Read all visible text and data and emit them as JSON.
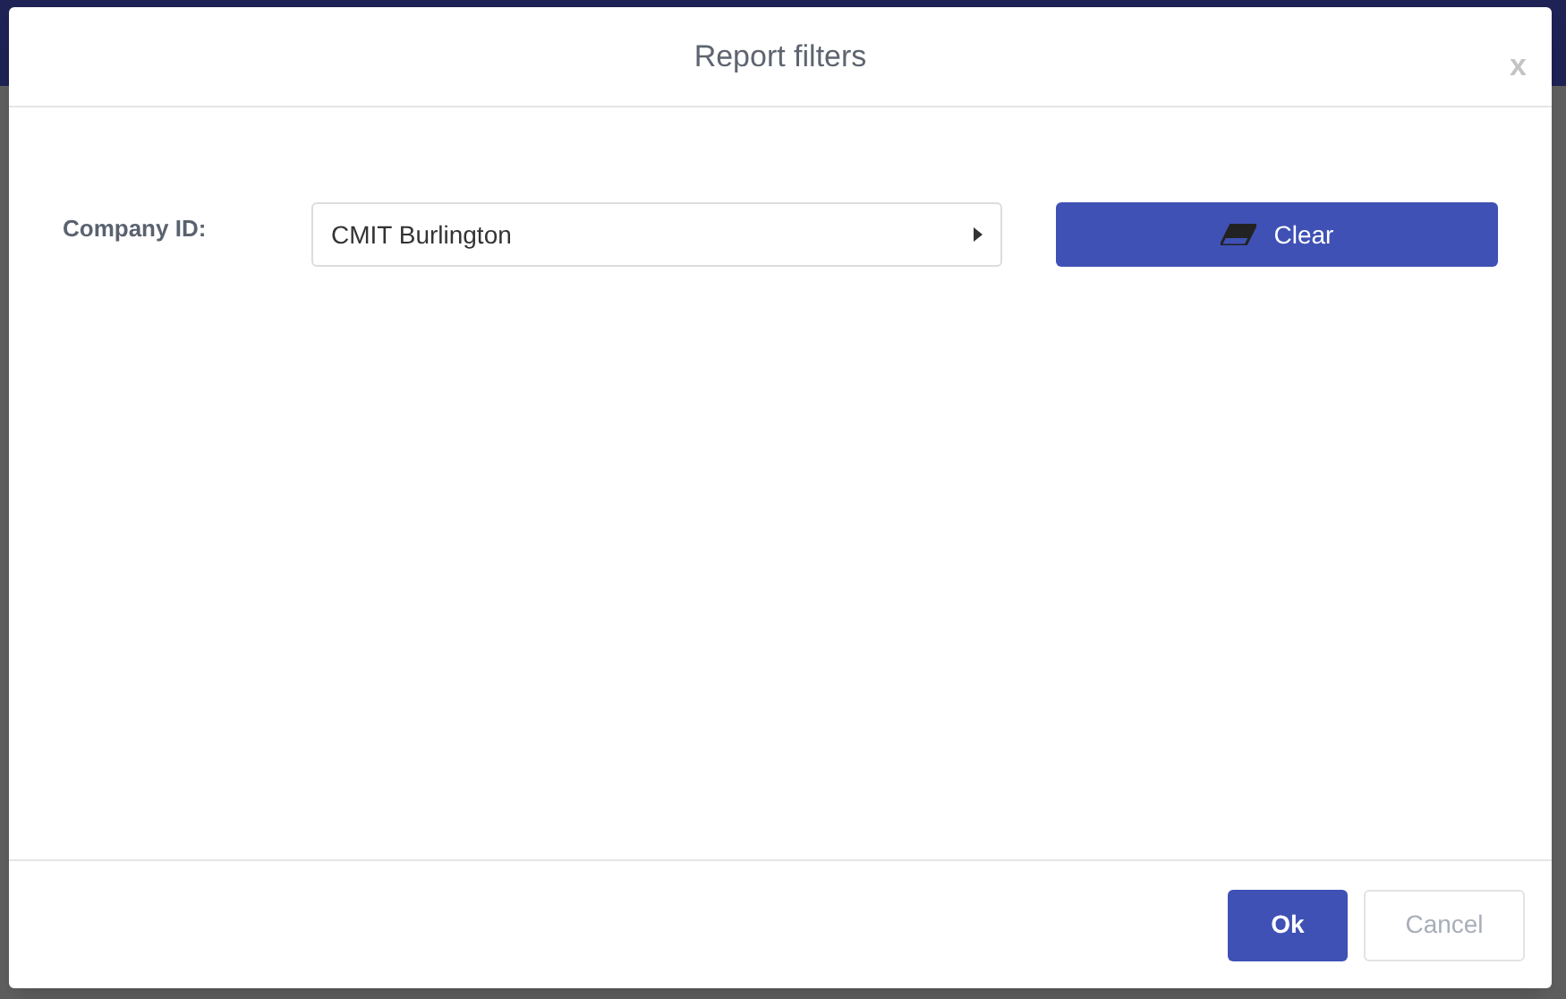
{
  "dialog": {
    "title": "Report filters",
    "close": "x"
  },
  "filters": [
    {
      "label": "Company ID:",
      "value": "CMIT Burlington"
    }
  ],
  "clear_button": "Clear",
  "buttons": [
    {
      "label": "Ok",
      "kind": "primary"
    },
    {
      "label": "Cancel",
      "kind": "secondary"
    }
  ]
}
